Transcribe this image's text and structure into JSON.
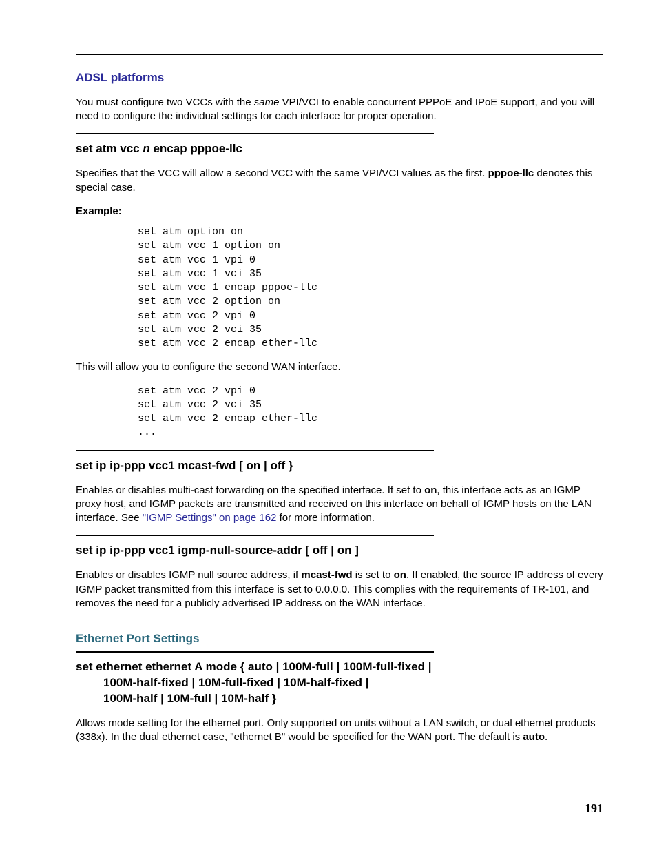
{
  "pageNumber": "191",
  "sec1_title": "ADSL platforms",
  "sec1_para_a": "You must configure two VCCs with the ",
  "sec1_para_b_same": "same",
  "sec1_para_c": " VPI/VCI to enable concurrent PPPoE and IPoE support, and you will need to configure the individual settings for each interface for proper operation.",
  "cmd1_a": "set atm vcc ",
  "cmd1_n": "n",
  "cmd1_b": " encap pppoe-llc",
  "cmd1_para_a": "Specifies that the VCC will allow a second VCC with the same VPI/VCI values as the first. ",
  "cmd1_para_bold": "pppoe-llc",
  "cmd1_para_b": " denotes this special case.",
  "example_label": "Example:",
  "code1": "set atm option on\nset atm vcc 1 option on\nset atm vcc 1 vpi 0\nset atm vcc 1 vci 35\nset atm vcc 1 encap pppoe-llc\nset atm vcc 2 option on\nset atm vcc 2 vpi 0\nset atm vcc 2 vci 35\nset atm vcc 2 encap ether-llc",
  "code1_after": "This will allow you to configure the second WAN interface.",
  "code2": "set atm vcc 2 vpi 0\nset atm vcc 2 vci 35\nset atm vcc 2 encap ether-llc\n...",
  "cmd2_title": "set ip ip-ppp vcc1 mcast-fwd [ on | off }",
  "cmd2_para_a": "Enables or disables multi-cast forwarding on the specified interface. If set to ",
  "cmd2_para_on": "on",
  "cmd2_para_b": ", this interface acts as an IGMP proxy host, and IGMP packets are transmitted and received on this interface on behalf of IGMP hosts on the LAN interface. See ",
  "cmd2_link": "\"IGMP Settings\" on page 162",
  "cmd2_para_c": " for more information.",
  "cmd3_title": "set ip ip-ppp vcc1 igmp-null-source-addr [ off | on ]",
  "cmd3_para_a": "Enables or disables IGMP null source address, if ",
  "cmd3_para_bold": "mcast-fwd",
  "cmd3_para_b": " is set to ",
  "cmd3_para_on": "on",
  "cmd3_para_c": ". If enabled, the source IP address of every IGMP packet transmitted from this interface is set to 0.0.0.0. This complies with the requirements of TR-101, and removes the need for a publicly advertised IP address on the WAN interface.",
  "sec2_title": "Ethernet Port Settings",
  "cmd4_line1": "set ethernet ethernet A mode { auto | 100M-full | 100M-full-fixed |",
  "cmd4_line2": "100M-half-fixed | 10M-full-fixed | 10M-half-fixed |",
  "cmd4_line3": "100M-half | 10M-full | 10M-half }",
  "cmd4_para_a": "Allows mode setting for the ethernet port. Only supported on units without a LAN switch, or dual ethernet products (338x). In the dual ethernet case, \"ethernet B\" would be specified for the WAN port. The default is ",
  "cmd4_para_bold": "auto",
  "cmd4_para_b": "."
}
